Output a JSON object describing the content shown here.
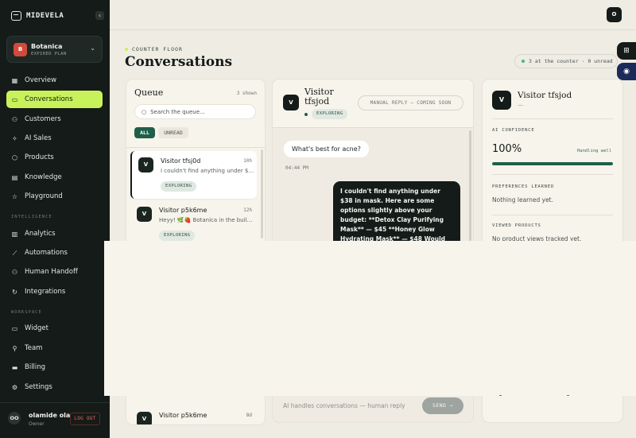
{
  "brand": {
    "name": "MIDEVELA"
  },
  "workspace": {
    "initial": "B",
    "name": "Botanica",
    "plan": "EXPIRED PLAN"
  },
  "nav": {
    "main": [
      {
        "label": "Overview",
        "icon": "grid-icon"
      },
      {
        "label": "Conversations",
        "icon": "chat-icon",
        "active": true
      },
      {
        "label": "Customers",
        "icon": "users-icon"
      },
      {
        "label": "AI Sales",
        "icon": "sparkle-icon"
      },
      {
        "label": "Products",
        "icon": "box-icon"
      },
      {
        "label": "Knowledge",
        "icon": "book-icon"
      },
      {
        "label": "Playground",
        "icon": "star-icon"
      }
    ],
    "intelligence_title": "INTELLIGENCE",
    "intelligence": [
      {
        "label": "Analytics",
        "icon": "bar-chart-icon"
      },
      {
        "label": "Automations",
        "icon": "wand-icon"
      },
      {
        "label": "Human Handoff",
        "icon": "handoff-icon"
      },
      {
        "label": "Integrations",
        "icon": "refresh-icon"
      }
    ],
    "workspace_title": "WORKSPACE",
    "workspace": [
      {
        "label": "Widget",
        "icon": "monitor-icon"
      },
      {
        "label": "Team",
        "icon": "person-icon"
      },
      {
        "label": "Billing",
        "icon": "card-icon"
      },
      {
        "label": "Settings",
        "icon": "gear-icon"
      }
    ]
  },
  "user": {
    "initials": "OO",
    "name": "olamide ola",
    "role": "Owner",
    "logout_label": "LOG OUT"
  },
  "topbar": {
    "avatar": "O"
  },
  "page": {
    "eyebrow": "COUNTER FLOOR",
    "title": "Conversations",
    "counter_status": "3 at the counter · 0 unread"
  },
  "queue": {
    "title": "Queue",
    "count": "3 shown",
    "search_placeholder": "Search the queue...",
    "filters": {
      "all": "ALL",
      "unread": "UNREAD"
    },
    "items": [
      {
        "initial": "V",
        "name": "Visitor tfsj0d",
        "time": "10h",
        "preview": "I couldn't find anything under $38 in mask.",
        "tag": "EXPLORING"
      },
      {
        "initial": "V",
        "name": "Visitor p5k6me",
        "time": "12h",
        "preview": "Heyy! 🌿🍓 Botanica in the building!",
        "tag": "EXPLORING"
      },
      {
        "initial": "V",
        "name": "Visitor p5k6me",
        "time": "8d"
      }
    ]
  },
  "chat": {
    "initial": "V",
    "name": "Visitor tfsjod",
    "tag": "EXPLORING",
    "mode": "MANUAL REPLY — COMING SOON",
    "messages": [
      {
        "from": "visitor",
        "text": "What's best for acne?",
        "time": "04:44 PM"
      },
      {
        "from": "ai",
        "text": "I couldn't find anything under $38 in mask. Here are some options slightly above your budget: **Detox Clay Purifying Mask** — $45 **Honey Glow Hydrating Mask** — $48 Would"
      }
    ],
    "composer_placeholder": "AI handles conversations — human reply",
    "send_label": "SEND →"
  },
  "insights": {
    "initial": "V",
    "name": "Visitor tfsjod",
    "subtitle": "—",
    "confidence_label": "AI CONFIDENCE",
    "confidence_value": "100%",
    "confidence_fraction": 1.0,
    "confidence_note": "Handling well",
    "preferences_label": "PREFERENCES LEARNED",
    "preferences_value": "Nothing learned yet.",
    "viewed_label": "VIEWED PRODUCTS",
    "viewed_value": "No product views tracked yet."
  },
  "colors": {
    "sidebar_bg": "#141b18",
    "accent": "#c8f25a",
    "brand_green": "#1f5f4a",
    "page_bg": "#efece4",
    "panel_bg": "#f7f4ec"
  }
}
